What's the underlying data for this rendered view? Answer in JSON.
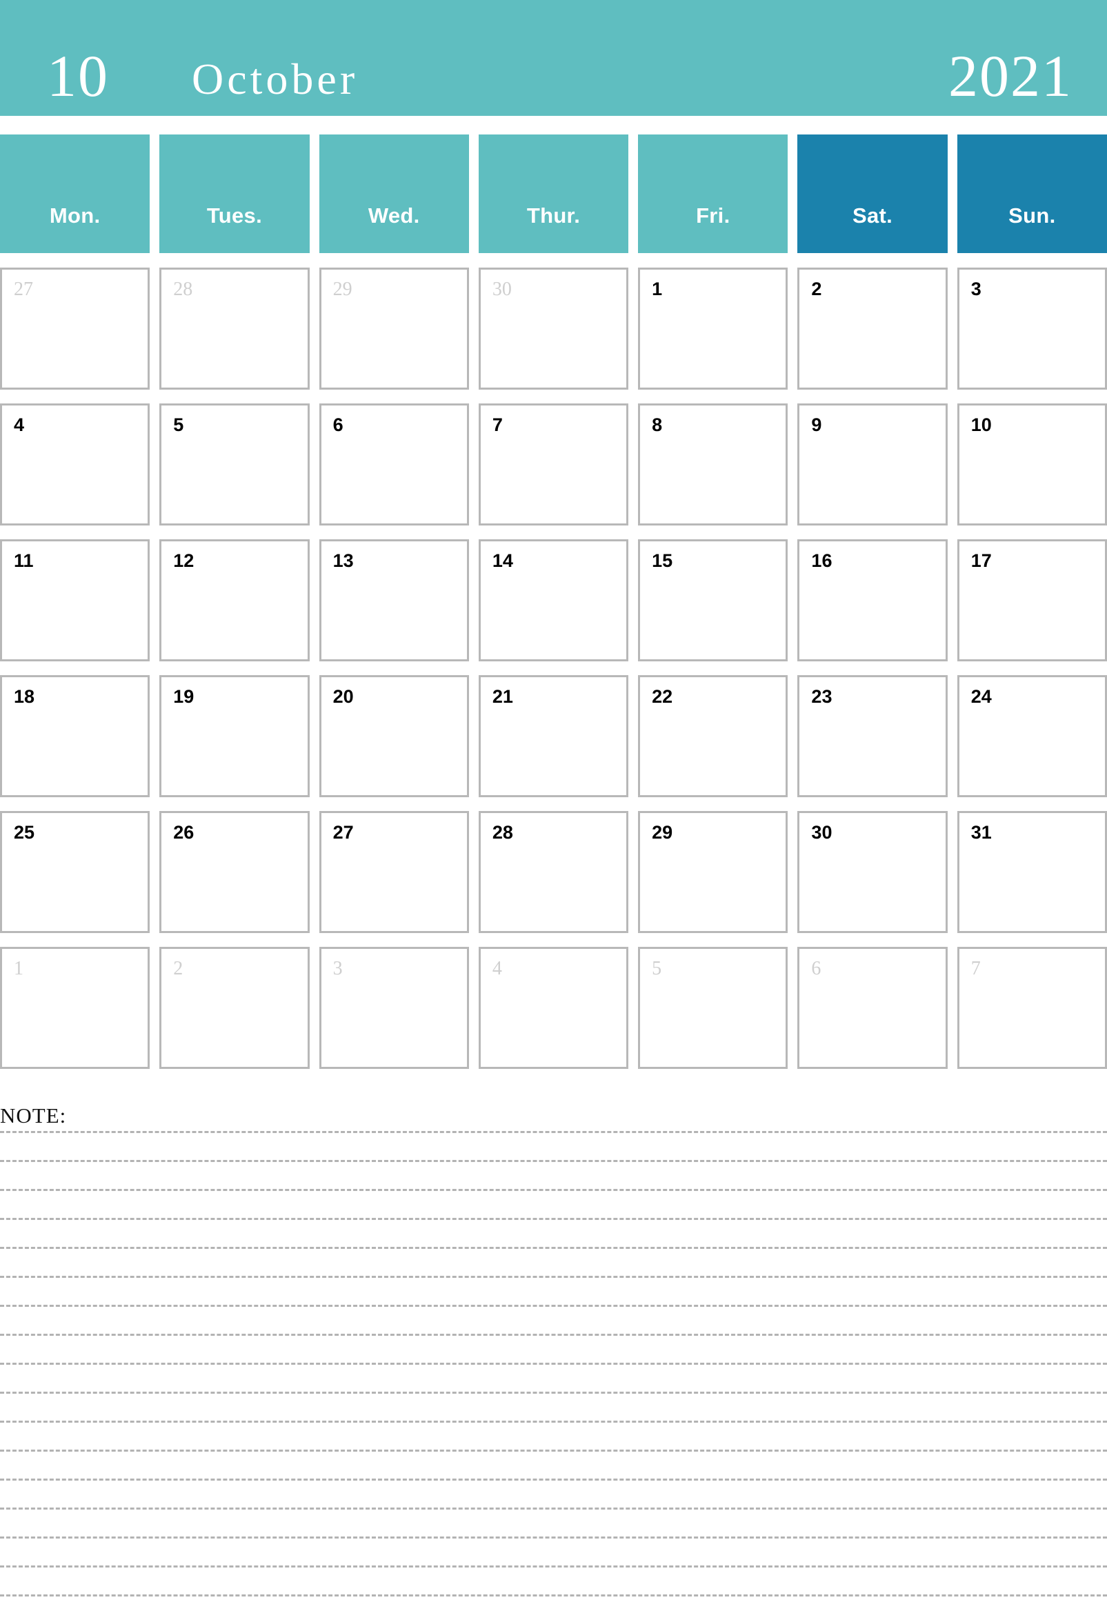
{
  "header": {
    "month_number": "10",
    "month_name": "October",
    "year": "2021"
  },
  "colors": {
    "weekday_teal": "#5FBEC0",
    "weekend_blue": "#1B82AC",
    "cell_border": "#b8b8b8",
    "other_month_text": "#cfcfcf",
    "current_month_text": "#000000",
    "note_line": "#b3b3b3"
  },
  "weekdays": [
    {
      "label": "Mon.",
      "weekend": false
    },
    {
      "label": "Tues.",
      "weekend": false
    },
    {
      "label": "Wed.",
      "weekend": false
    },
    {
      "label": "Thur.",
      "weekend": false
    },
    {
      "label": "Fri.",
      "weekend": false
    },
    {
      "label": "Sat.",
      "weekend": true
    },
    {
      "label": "Sun.",
      "weekend": true
    }
  ],
  "weeks": [
    [
      {
        "day": "27",
        "current_month": false
      },
      {
        "day": "28",
        "current_month": false
      },
      {
        "day": "29",
        "current_month": false
      },
      {
        "day": "30",
        "current_month": false
      },
      {
        "day": "1",
        "current_month": true
      },
      {
        "day": "2",
        "current_month": true
      },
      {
        "day": "3",
        "current_month": true
      }
    ],
    [
      {
        "day": "4",
        "current_month": true
      },
      {
        "day": "5",
        "current_month": true
      },
      {
        "day": "6",
        "current_month": true
      },
      {
        "day": "7",
        "current_month": true
      },
      {
        "day": "8",
        "current_month": true
      },
      {
        "day": "9",
        "current_month": true
      },
      {
        "day": "10",
        "current_month": true
      }
    ],
    [
      {
        "day": "11",
        "current_month": true
      },
      {
        "day": "12",
        "current_month": true
      },
      {
        "day": "13",
        "current_month": true
      },
      {
        "day": "14",
        "current_month": true
      },
      {
        "day": "15",
        "current_month": true
      },
      {
        "day": "16",
        "current_month": true
      },
      {
        "day": "17",
        "current_month": true
      }
    ],
    [
      {
        "day": "18",
        "current_month": true
      },
      {
        "day": "19",
        "current_month": true
      },
      {
        "day": "20",
        "current_month": true
      },
      {
        "day": "21",
        "current_month": true
      },
      {
        "day": "22",
        "current_month": true
      },
      {
        "day": "23",
        "current_month": true
      },
      {
        "day": "24",
        "current_month": true
      }
    ],
    [
      {
        "day": "25",
        "current_month": true
      },
      {
        "day": "26",
        "current_month": true
      },
      {
        "day": "27",
        "current_month": true
      },
      {
        "day": "28",
        "current_month": true
      },
      {
        "day": "29",
        "current_month": true
      },
      {
        "day": "30",
        "current_month": true
      },
      {
        "day": "31",
        "current_month": true
      }
    ],
    [
      {
        "day": "1",
        "current_month": false
      },
      {
        "day": "2",
        "current_month": false
      },
      {
        "day": "3",
        "current_month": false
      },
      {
        "day": "4",
        "current_month": false
      },
      {
        "day": "5",
        "current_month": false
      },
      {
        "day": "6",
        "current_month": false
      },
      {
        "day": "7",
        "current_month": false
      }
    ]
  ],
  "note": {
    "label": "NOTE:",
    "line_count": 17
  }
}
